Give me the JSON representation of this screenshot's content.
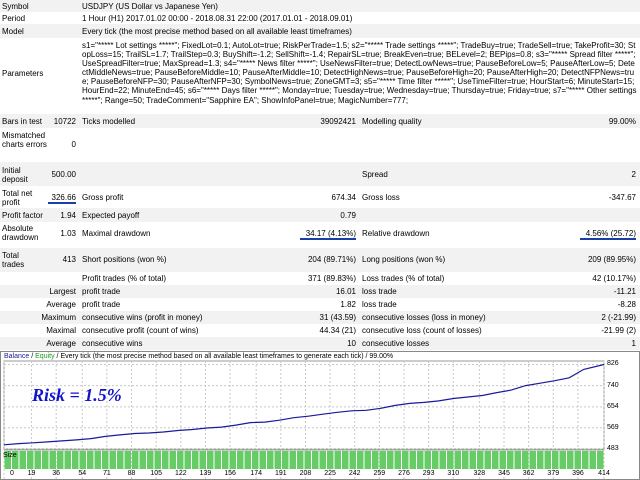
{
  "report": {
    "symbol_label": "Symbol",
    "symbol_value": "USDJPY (US Dollar vs Japanese Yen)",
    "period_label": "Period",
    "period_value": "1 Hour (H1) 2017.01.02 00:00 - 2018.08.31 22:00 (2017.01.01 - 2018.09.01)",
    "model_label": "Model",
    "model_value": "Every tick (the most precise method based on all available least timeframes)",
    "parameters_label": "Parameters",
    "parameters_value": "s1=\"***** Lot settings *****\"; FixedLot=0.1; AutoLot=true; RiskPerTrade=1.5; s2=\"***** Trade settings *****\"; TradeBuy=true; TradeSell=true; TakeProfit=30; StopLoss=15; TrailSL=1.7; TrailStep=0.3; BuyShift=-1.2; SellShift=-1.4; RepairSL=true; BreakEven=true; BELevel=2; BEPips=0.8; s3=\"***** Spread filter *****\"; UseSpreadFilter=true; MaxSpread=1.3; s4=\"***** News filter *****\"; UseNewsFilter=true; DetectLowNews=true; PauseBeforeLow=5; PauseAfterLow=5; DetectMiddleNews=true; PauseBeforeMiddle=10; PauseAfterMiddle=10; DetectHighNews=true; PauseBeforeHigh=20; PauseAfterHigh=20; DetectNFPNews=true; PauseBeforeNFP=30; PauseAfterNFP=30; SymbolNews=true; ZoneGMT=3; s5=\"***** Time filter *****\"; UseTimeFilter=true; HourStart=6; MinuteStart=15; HourEnd=22; MinuteEnd=45; s6=\"***** Days filter *****\"; Monday=true; Tuesday=true; Wednesday=true; Thursday=true; Friday=true; s7=\"***** Other settings *****\"; Range=50; TradeComment=\"Sapphire EA\"; ShowInfoPanel=true; MagicNumber=777;",
    "bars_label": "Bars in test",
    "bars_value": "10722",
    "ticks_label": "Ticks modelled",
    "ticks_value": "39092421",
    "quality_label": "Modelling quality",
    "quality_value": "99.00%",
    "mismatch_label": "Mismatched charts errors",
    "mismatch_value": "0",
    "deposit_label": "Initial deposit",
    "deposit_value": "500.00",
    "spread_label": "Spread",
    "spread_value": "2",
    "net_label": "Total net profit",
    "net_value": "326.66",
    "gross_profit_label": "Gross profit",
    "gross_profit_value": "674.34",
    "gross_loss_label": "Gross loss",
    "gross_loss_value": "-347.67",
    "pf_label": "Profit factor",
    "pf_value": "1.94",
    "payoff_label": "Expected payoff",
    "payoff_value": "0.79",
    "abs_dd_label": "Absolute drawdown",
    "abs_dd_value": "1.03",
    "max_dd_label": "Maximal drawdown",
    "max_dd_value": "34.17 (4.13%)",
    "rel_dd_label": "Relative drawdown",
    "rel_dd_value": "4.56% (25.72)",
    "trades_label": "Total trades",
    "trades_value": "413",
    "short_label": "Short positions (won %)",
    "short_value": "204 (89.71%)",
    "long_label": "Long positions (won %)",
    "long_value": "209 (89.95%)",
    "profit_trades_label": "Profit trades (% of total)",
    "profit_trades_value": "371 (89.83%)",
    "loss_trades_label": "Loss trades (% of total)",
    "loss_trades_value": "42 (10.17%)",
    "largest_label": "Largest",
    "largest_profit_label": "profit trade",
    "largest_profit_value": "16.01",
    "largest_loss_label": "loss trade",
    "largest_loss_value": "-11.21",
    "average_label": "Average",
    "avg_profit_label": "profit trade",
    "avg_profit_value": "1.82",
    "avg_loss_label": "loss trade",
    "avg_loss_value": "-8.28",
    "maximum_label": "Maximum",
    "max_cons_wins_label": "consecutive wins (profit in money)",
    "max_cons_wins_value": "31 (43.59)",
    "max_cons_losses_label": "consecutive losses (loss in money)",
    "max_cons_losses_value": "2 (-21.99)",
    "maximal_label": "Maximal",
    "maxl_cons_profit_label": "consecutive profit (count of wins)",
    "maxl_cons_profit_value": "44.34 (21)",
    "maxl_cons_loss_label": "consecutive loss (count of losses)",
    "maxl_cons_loss_value": "-21.99 (2)",
    "average2_label": "Average",
    "avg_cons_wins_label": "consecutive wins",
    "avg_cons_wins_value": "10",
    "avg_cons_losses_label": "consecutive losses",
    "avg_cons_losses_value": "1"
  },
  "chart": {
    "title_balance": "Balance",
    "title_sep1": " / ",
    "title_equity": "Equity",
    "title_rest": " / Every tick (the most precise method based on all available least timeframes to generate each tick) / 99.00%",
    "annotation": "Risk = 1.5%",
    "size_label": "Size",
    "colors": {
      "balance": "#1a1a9a",
      "grid": "#c8c8c8",
      "size_bars": "#66cc66",
      "annotation": "#1212cc"
    }
  },
  "chart_data": {
    "type": "line",
    "title": "",
    "y_ticks": [
      "826",
      "740",
      "654",
      "569",
      "483"
    ],
    "ylim": [
      483,
      840
    ],
    "x_ticks": [
      "0",
      "19",
      "36",
      "54",
      "71",
      "88",
      "105",
      "122",
      "139",
      "156",
      "174",
      "191",
      "208",
      "225",
      "242",
      "259",
      "276",
      "293",
      "310",
      "328",
      "345",
      "362",
      "379",
      "396",
      "414"
    ],
    "xlim": [
      0,
      414
    ],
    "series": [
      {
        "x": [
          0,
          10,
          20,
          30,
          40,
          50,
          60,
          70,
          80,
          90,
          100,
          110,
          120,
          130,
          140,
          150,
          160,
          170,
          180,
          190,
          200,
          210,
          220,
          230,
          240,
          250,
          260,
          270,
          280,
          290,
          300,
          310,
          320,
          330,
          340,
          350,
          360,
          370,
          380,
          390,
          400,
          414
        ],
        "y": [
          500,
          505,
          508,
          512,
          516,
          520,
          525,
          534,
          540,
          546,
          548,
          552,
          558,
          562,
          568,
          572,
          580,
          590,
          592,
          600,
          610,
          616,
          624,
          632,
          638,
          640,
          648,
          660,
          668,
          672,
          678,
          688,
          694,
          700,
          712,
          722,
          740,
          750,
          760,
          772,
          806,
          826
        ]
      }
    ],
    "size_values": [
      1,
      1,
      1,
      1,
      1,
      1,
      1,
      1,
      1,
      1,
      1,
      1,
      1,
      1,
      1,
      1,
      1,
      1,
      1,
      1,
      1,
      1,
      1,
      1,
      1,
      1,
      1,
      1,
      1,
      1,
      1,
      1,
      1,
      1,
      1,
      1,
      1,
      1,
      1,
      1,
      1,
      1,
      1,
      1,
      1,
      1,
      1,
      1,
      1,
      1,
      1,
      1,
      1,
      1,
      1,
      1,
      1,
      1,
      1,
      1,
      1,
      1,
      1,
      1,
      1,
      1,
      1,
      1,
      1,
      1,
      1,
      1,
      1,
      1,
      1,
      1,
      1,
      1,
      1,
      1
    ]
  }
}
